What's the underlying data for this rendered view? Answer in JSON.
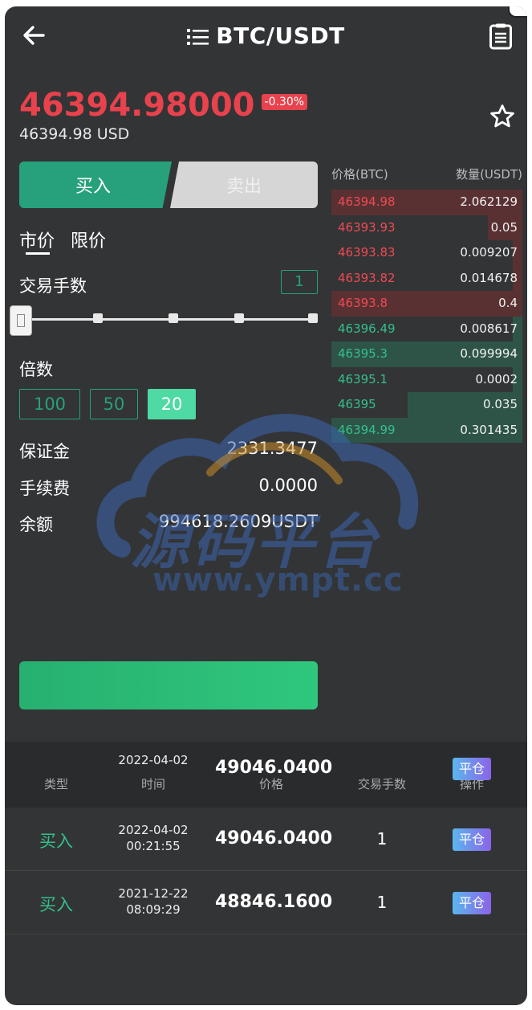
{
  "header": {
    "title": "BTC/USDT"
  },
  "ticker": {
    "price": "46394.98000",
    "change": "-0.30%",
    "usd": "46394.98 USD"
  },
  "trade": {
    "buy_label": "买入",
    "sell_label": "卖出",
    "tabs": [
      "市价",
      "限价"
    ],
    "lot_label": "交易手数",
    "lot_value": "1",
    "slider_level": 0,
    "multiplier_label": "倍数",
    "multipliers": [
      "100",
      "50",
      "20"
    ],
    "multiplier_selected": "20",
    "margin_label": "保证金",
    "margin_value": "2331.3477",
    "fee_label": "手续费",
    "fee_value": "0.0000",
    "balance_label": "余额",
    "balance_value": "994618.2609USDT"
  },
  "orderbook": {
    "price_header": "价格(BTC)",
    "qty_header": "数量(USDT)",
    "asks": [
      {
        "price": "46394.98",
        "qty": "2.062129",
        "depth": 1.0
      },
      {
        "price": "46393.93",
        "qty": "0.05",
        "depth": 0.18
      },
      {
        "price": "46393.83",
        "qty": "0.009207",
        "depth": 0.05
      },
      {
        "price": "46393.82",
        "qty": "0.014678",
        "depth": 0.05
      },
      {
        "price": "46393.8",
        "qty": "0.4",
        "depth": 1.0
      }
    ],
    "bids": [
      {
        "price": "46396.49",
        "qty": "0.008617",
        "depth": 0.05
      },
      {
        "price": "46395.3",
        "qty": "0.099994",
        "depth": 1.0
      },
      {
        "price": "46395.1",
        "qty": "0.0002",
        "depth": 0.05
      },
      {
        "price": "46395",
        "qty": "0.035",
        "depth": 0.6
      },
      {
        "price": "46394.99",
        "qty": "0.301435",
        "depth": 1.0
      }
    ]
  },
  "positions": {
    "headers": {
      "type": "类型",
      "time": "时间",
      "price": "价格",
      "qty": "交易手数",
      "op": "操作"
    },
    "header_overlay": {
      "date": "2022-04-02",
      "price": "49046.0400",
      "op": "平仓"
    },
    "rows": [
      {
        "type": "买入",
        "date": "2022-04-02",
        "time": "00:21:55",
        "price": "49046.0400",
        "qty": "1",
        "op": "平仓"
      },
      {
        "type": "买入",
        "date": "2021-12-22",
        "time": "08:09:29",
        "price": "48846.1600",
        "qty": "1",
        "op": "平仓"
      }
    ]
  },
  "watermark": {
    "text": "源码平台",
    "url": "www.ympt.cc"
  },
  "colors": {
    "buy": "#26a17b",
    "sell": "#e8424d",
    "background": "#333436"
  }
}
